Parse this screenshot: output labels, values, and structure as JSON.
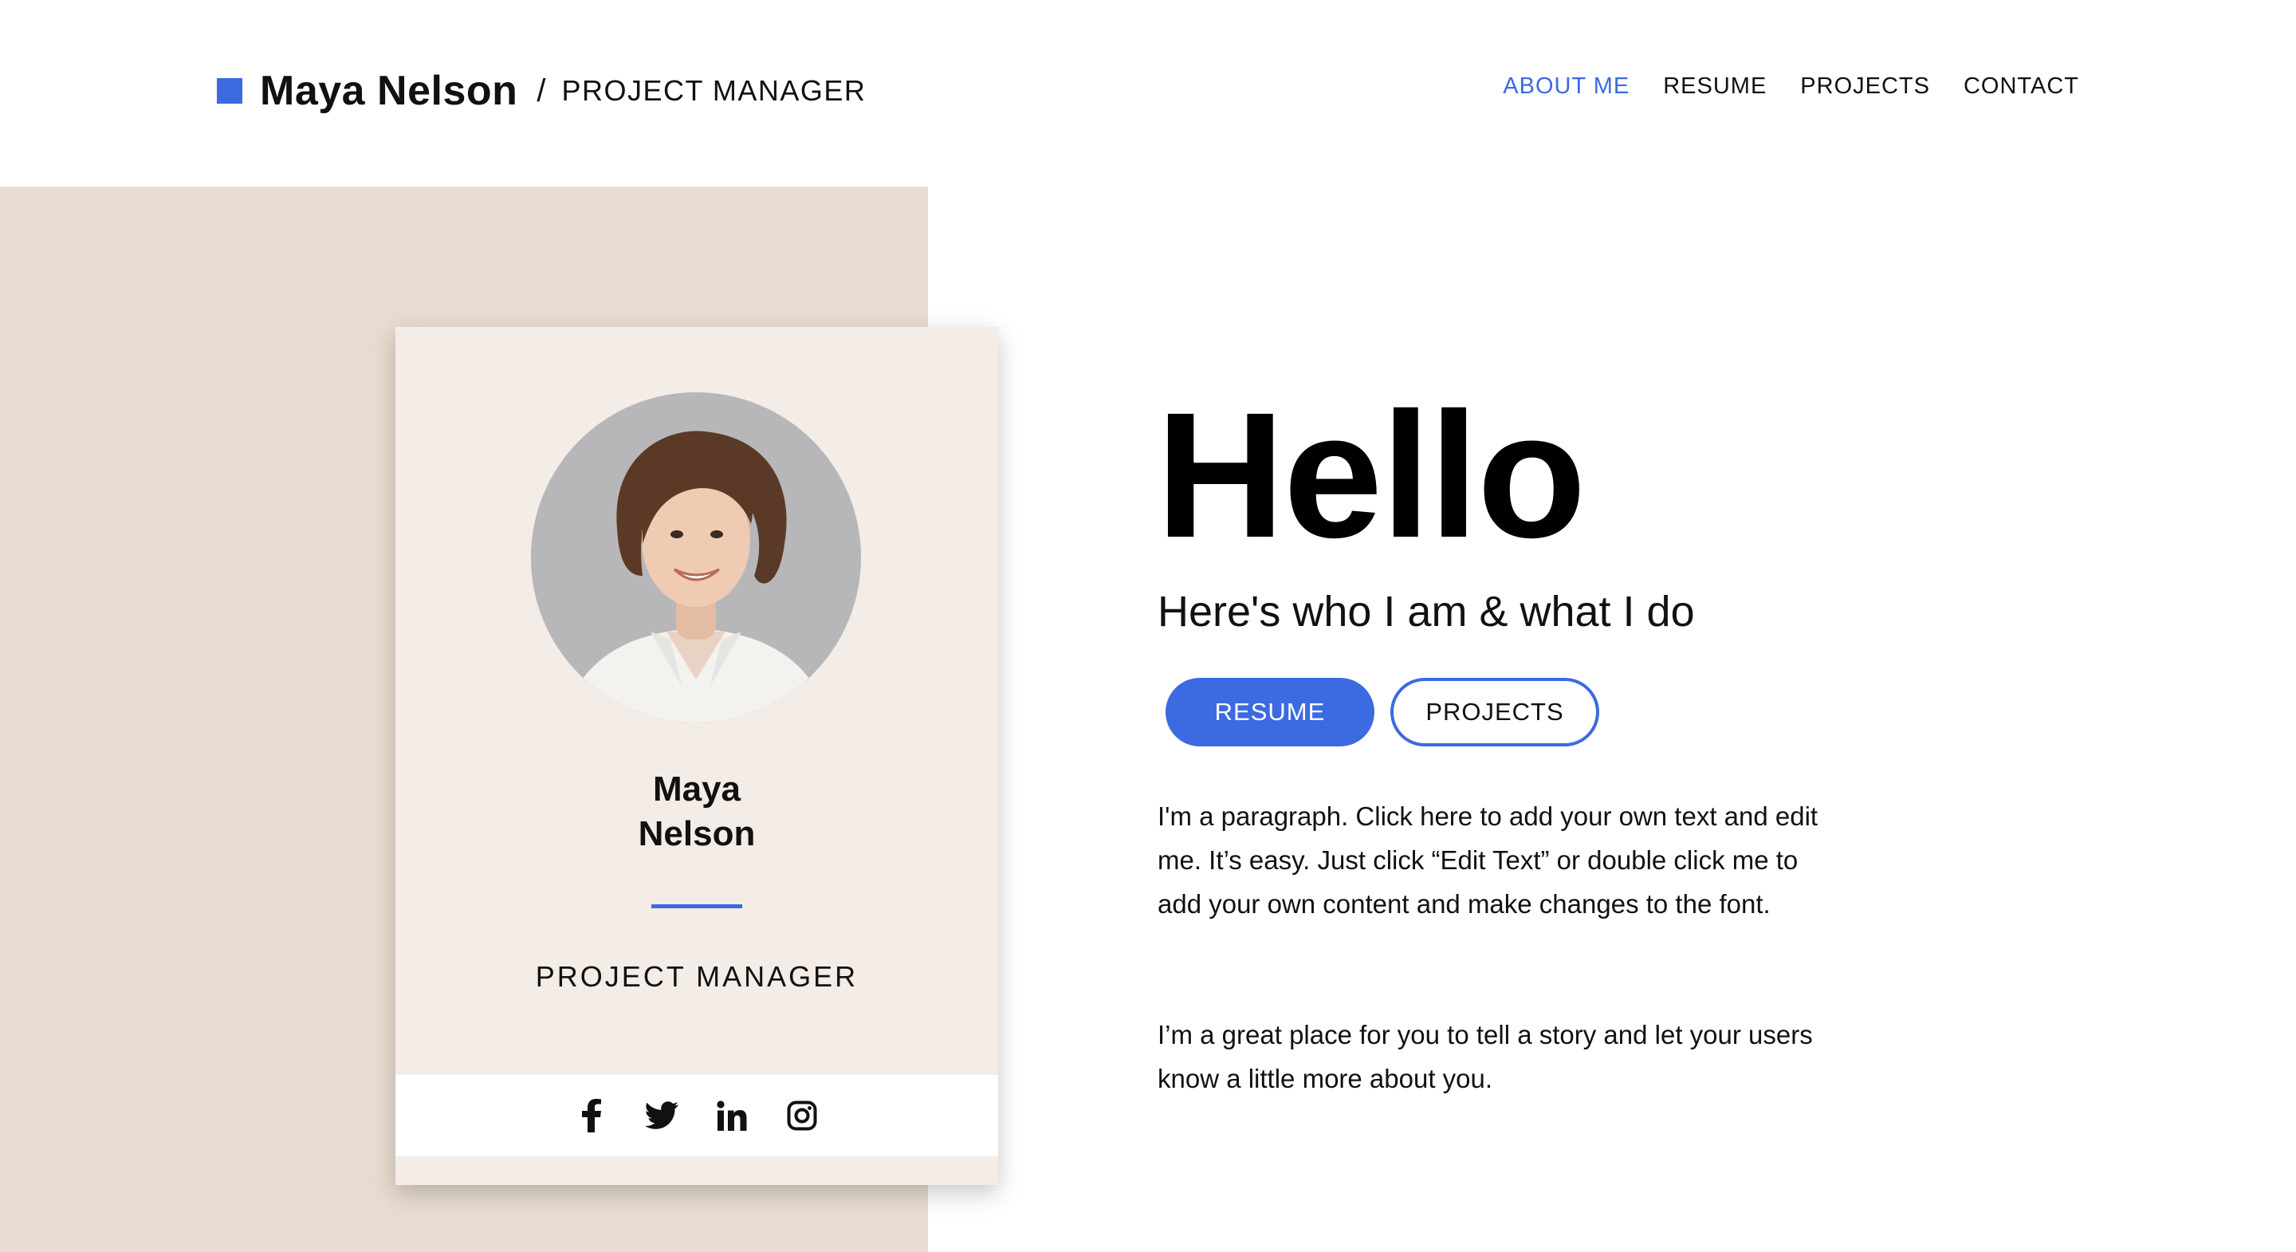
{
  "header": {
    "brand_name": "Maya Nelson",
    "brand_separator": "/",
    "brand_title": "PROJECT MANAGER",
    "nav": [
      {
        "label": "ABOUT ME",
        "active": true
      },
      {
        "label": "RESUME",
        "active": false
      },
      {
        "label": "PROJECTS",
        "active": false
      },
      {
        "label": "CONTACT",
        "active": false
      }
    ]
  },
  "card": {
    "name_line1": "Maya",
    "name_line2": "Nelson",
    "role": "PROJECT MANAGER",
    "socials": [
      "facebook-icon",
      "twitter-icon",
      "linkedin-icon",
      "instagram-icon"
    ]
  },
  "main": {
    "heading": "Hello",
    "subtitle": "Here's who I am & what I do",
    "resume_button": "RESUME",
    "projects_button": "PROJECTS",
    "paragraph1": "I'm a paragraph. Click here to add your own text and edit me. It’s easy. Just click “Edit Text” or double click me to add your own content and make changes to the font.",
    "paragraph2": "I’m a great place for you to tell a story and let your users know a little more about you."
  },
  "colors": {
    "accent": "#3c6ae0",
    "backdrop": "#e8dcd0",
    "card": "#f4ece6"
  }
}
